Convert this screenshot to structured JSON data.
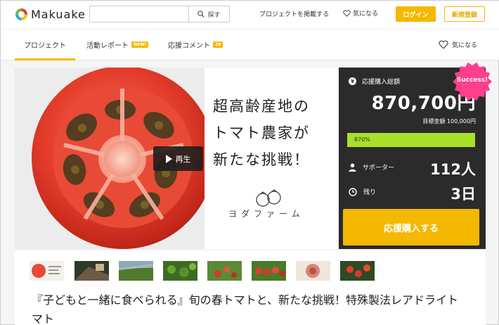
{
  "header": {
    "logo_text": "Makuake",
    "search_placeholder": "",
    "search_button": "探す",
    "post_project": "プロジェクトを掲載する",
    "favorite": "気になる",
    "login": "ログイン",
    "signup": "新規登録"
  },
  "tabs": {
    "project": "プロジェクト",
    "report": "活動レポート",
    "report_badge": "NEW!",
    "comment": "応援コメント",
    "comment_badge": "28",
    "favorite": "気になる"
  },
  "hero": {
    "copy_line1": "超高齢産地の",
    "copy_line2": "トマト農家が",
    "copy_line3": "新たな挑戦！",
    "farm_name": "ヨダファーム",
    "play_label": "再生"
  },
  "panel": {
    "total_label": "応援購入総額",
    "amount": "870,700円",
    "goal_label": "目標金額",
    "goal_value": "100,000円",
    "progress_percent": 870,
    "progress_text": "870%",
    "supporters_label": "サポーター",
    "supporters_value": "112人",
    "remaining_label": "残り",
    "remaining_value": "3日",
    "cta": "応援購入する",
    "success_badge": "Success!"
  },
  "title": "『子どもと一緒に食べられる』旬の春トマトと、新たな挑戦！特殊製法レアドライトマト",
  "colors": {
    "accent": "#f5b800",
    "progress": "#a8e02a",
    "success": "#ff3e8c",
    "panel_bg": "#2b2b2b"
  }
}
